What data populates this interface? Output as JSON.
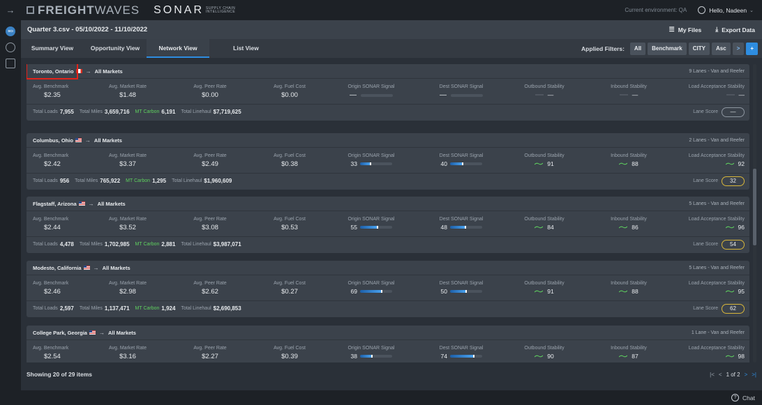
{
  "topbar": {
    "brand_bold": "FREIGHT",
    "brand_light": "WAVES",
    "product": "SONAR",
    "product_sub_1": "SUPPLY CHAIN",
    "product_sub_2": "INTELLIGENCE",
    "environment": "Current environment: QA",
    "greeting": "Hello, Nadeen"
  },
  "rail": {
    "sci_label": "SCI"
  },
  "filebar": {
    "title": "Quarter 3.csv - 05/10/2022 - 11/10/2022",
    "my_files": "My Files",
    "export": "Export Data"
  },
  "tabs": [
    {
      "label": "Summary View"
    },
    {
      "label": "Opportunity View"
    },
    {
      "label": "Network View",
      "active": true
    },
    {
      "label": "List View"
    }
  ],
  "filters": {
    "label": "Applied Filters:",
    "chips": [
      "All",
      "Benchmark",
      "CITY",
      "Asc"
    ],
    "next": ">",
    "add": "+"
  },
  "metric_labels": {
    "benchmark": "Avg. Benchmark",
    "market_rate": "Avg. Market Rate",
    "peer_rate": "Avg. Peer Rate",
    "fuel_cost": "Avg. Fuel Cost",
    "origin_signal": "Origin SONAR Signal",
    "dest_signal": "Dest SONAR Signal",
    "outbound": "Outbound Stability",
    "inbound": "Inbound Stability",
    "load_acceptance": "Load Acceptance Stability",
    "total_loads": "Total Loads",
    "total_miles": "Total Miles",
    "mt_carbon": "MT Carbon",
    "total_linehaul": "Total Linehaul",
    "lane_score": "Lane Score"
  },
  "cards": [
    {
      "origin": "Toronto, Ontario",
      "dest": "All Markets",
      "lanes": "9 Lanes - Van and Reefer",
      "benchmark": "$2.35",
      "market_rate": "$1.48",
      "peer_rate": "$0.00",
      "fuel_cost": "$0.00",
      "origin_signal": "—",
      "dest_signal": "—",
      "outbound": "—",
      "inbound": "—",
      "load_acceptance": "—",
      "total_loads": "7,955",
      "total_miles": "3,659,716",
      "mt_carbon": "6,191",
      "total_linehaul": "$7,719,625",
      "lane_score": "—"
    },
    {
      "origin": "Columbus, Ohio",
      "dest": "All Markets",
      "lanes": "2 Lanes - Van and Reefer",
      "benchmark": "$2.42",
      "market_rate": "$3.37",
      "peer_rate": "$2.49",
      "fuel_cost": "$0.38",
      "origin_signal": "33",
      "dest_signal": "40",
      "outbound": "91",
      "inbound": "88",
      "load_acceptance": "92",
      "total_loads": "956",
      "total_miles": "765,922",
      "mt_carbon": "1,295",
      "total_linehaul": "$1,960,609",
      "lane_score": "32"
    },
    {
      "origin": "Flagstaff, Arizona",
      "dest": "All Markets",
      "lanes": "5 Lanes - Van and Reefer",
      "benchmark": "$2.44",
      "market_rate": "$3.52",
      "peer_rate": "$3.08",
      "fuel_cost": "$0.53",
      "origin_signal": "55",
      "dest_signal": "48",
      "outbound": "84",
      "inbound": "86",
      "load_acceptance": "96",
      "total_loads": "4,478",
      "total_miles": "1,702,985",
      "mt_carbon": "2,881",
      "total_linehaul": "$3,987,071",
      "lane_score": "54"
    },
    {
      "origin": "Modesto, California",
      "dest": "All Markets",
      "lanes": "5 Lanes - Van and Reefer",
      "benchmark": "$2.46",
      "market_rate": "$2.98",
      "peer_rate": "$2.62",
      "fuel_cost": "$0.27",
      "origin_signal": "69",
      "dest_signal": "50",
      "outbound": "91",
      "inbound": "88",
      "load_acceptance": "95",
      "total_loads": "2,597",
      "total_miles": "1,137,471",
      "mt_carbon": "1,924",
      "total_linehaul": "$2,690,853",
      "lane_score": "62"
    },
    {
      "origin": "College Park, Georgia",
      "dest": "All Markets",
      "lanes": "1 Lane - Van and Reefer",
      "benchmark": "$2.54",
      "market_rate": "$3.16",
      "peer_rate": "$2.27",
      "fuel_cost": "$0.39",
      "origin_signal": "38",
      "dest_signal": "74",
      "outbound": "90",
      "inbound": "87",
      "load_acceptance": "98"
    }
  ],
  "footer": {
    "showing": "Showing 20 of 29 items",
    "page": "1 of 2"
  },
  "chat": {
    "label": "Chat"
  },
  "colors": {
    "accent": "#2e8de0",
    "highlight": "#e2231a",
    "carbon": "#5fd05f",
    "score_gold": "#d8b63a"
  }
}
